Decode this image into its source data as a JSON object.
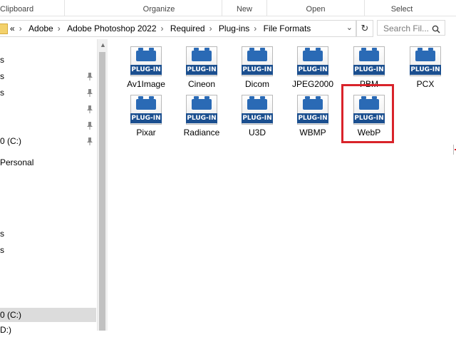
{
  "ribbon": {
    "groups": [
      {
        "label": "Clipboard"
      },
      {
        "label": "Organize"
      },
      {
        "label": "New"
      },
      {
        "label": "Open"
      },
      {
        "label": "Select"
      }
    ]
  },
  "address": {
    "crumbs": [
      "«",
      "Adobe",
      "Adobe Photoshop 2022",
      "Required",
      "Plug-ins",
      "File Formats"
    ],
    "search_placeholder": "Search Fil..."
  },
  "nav": {
    "items": [
      {
        "label": "s",
        "pinned": false
      },
      {
        "label": "s",
        "pinned": true
      },
      {
        "label": "s",
        "pinned": true
      },
      {
        "label": "",
        "pinned": true
      },
      {
        "label": "",
        "pinned": true
      },
      {
        "label": "0 (C:)",
        "pinned": true
      },
      {
        "label": "Personal",
        "pinned": false
      },
      {
        "label": "s",
        "pinned": false
      },
      {
        "label": "s",
        "pinned": false
      },
      {
        "label": "0 (C:)",
        "pinned": false,
        "selected": true
      },
      {
        "label": "D:)",
        "pinned": false
      }
    ]
  },
  "files": {
    "badge": "PLUG-IN",
    "items": [
      {
        "name": "Av1Image"
      },
      {
        "name": "Cineon"
      },
      {
        "name": "Dicom"
      },
      {
        "name": "JPEG2000"
      },
      {
        "name": "PBM"
      },
      {
        "name": "PCX"
      },
      {
        "name": "Pixar"
      },
      {
        "name": "Radiance"
      },
      {
        "name": "U3D"
      },
      {
        "name": "WBMP"
      },
      {
        "name": "WebP",
        "highlighted": true
      }
    ]
  },
  "colors": {
    "accent_highlight": "#d9232a",
    "plugin_blue": "#2a6ab5",
    "plugin_band": "#1b4f8f"
  }
}
